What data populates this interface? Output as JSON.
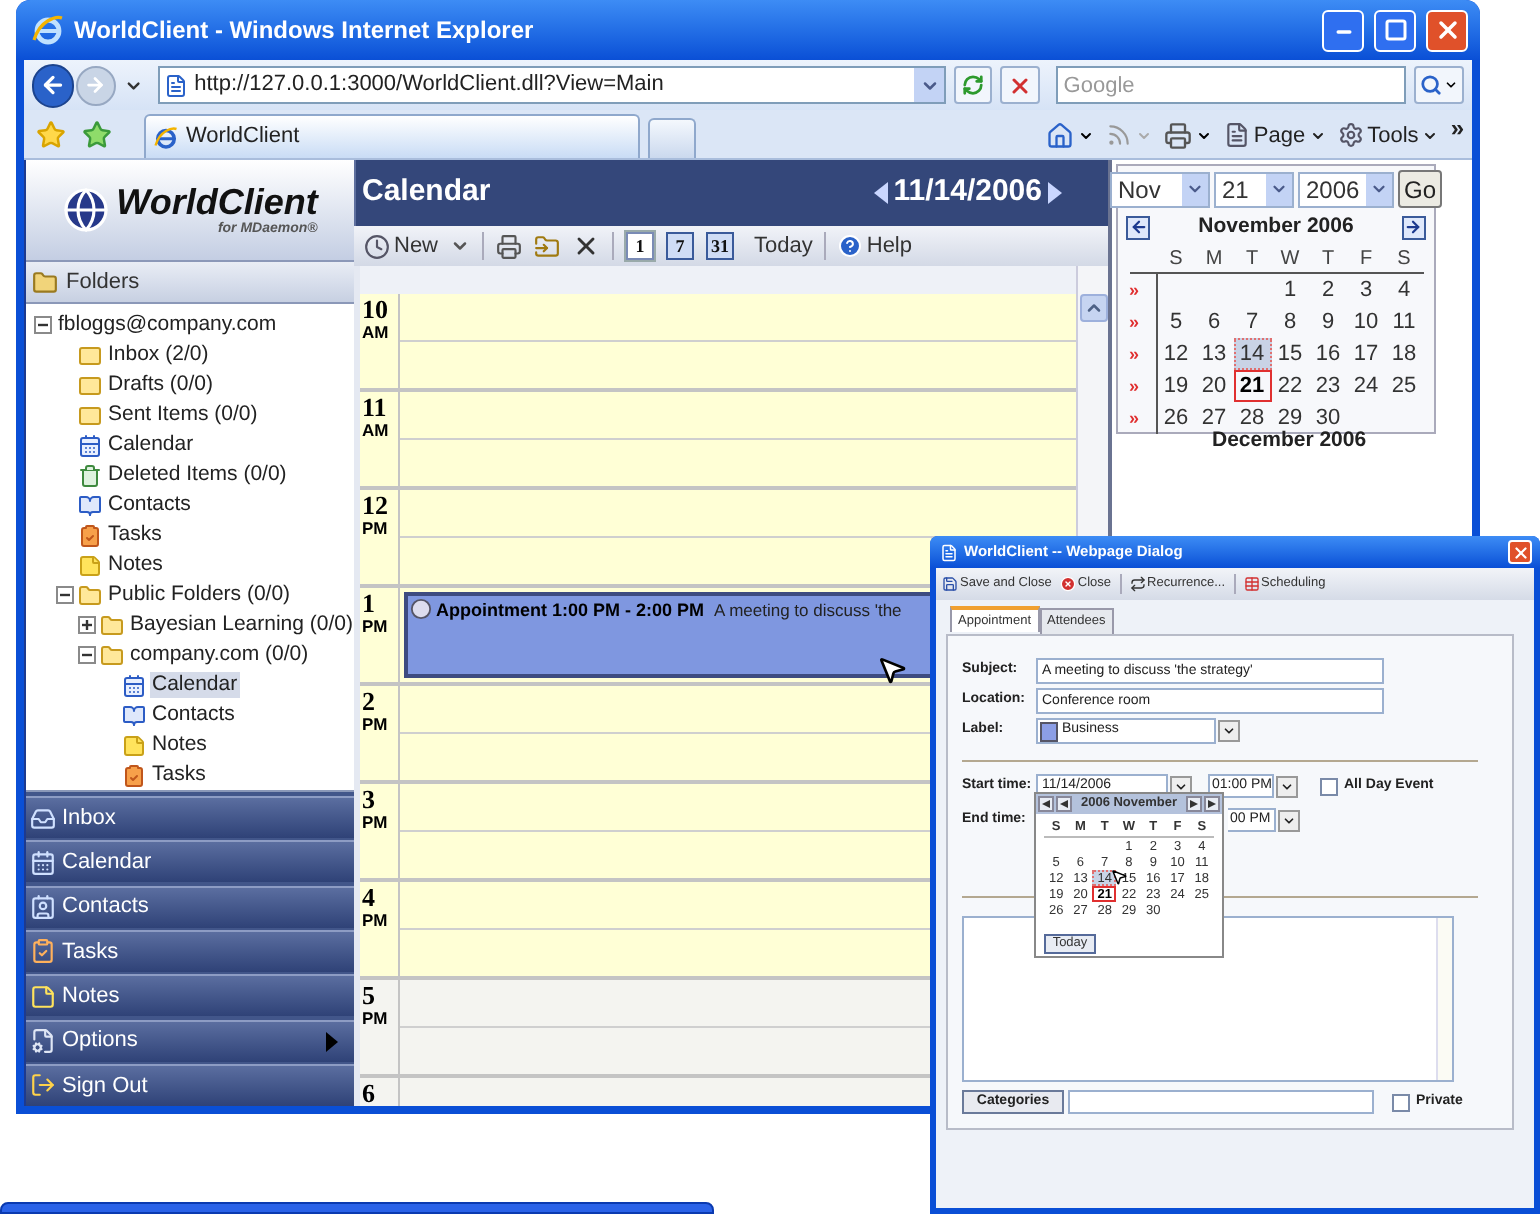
{
  "browser": {
    "title": "WorldClient - Windows Internet Explorer",
    "address": "http://127.0.0.1:3000/WorldClient.dll?View=Main",
    "search_placeholder": "Google",
    "tab": "WorldClient",
    "commands": [
      {
        "label": "Page",
        "kind": "page"
      },
      {
        "label": "Tools",
        "kind": "tools"
      }
    ],
    "more": "»"
  },
  "logo": {
    "title": "WorldClient",
    "subtitle": "for MDaemon®"
  },
  "folders": {
    "title": "Folders",
    "tree": [
      {
        "label": "fbloggs@company.com",
        "expanded": true,
        "selected": false,
        "children": [
          {
            "label": "Inbox (2/0)",
            "kind": "mail",
            "selected": false
          },
          {
            "label": "Drafts (0/0)",
            "kind": "mail",
            "selected": false
          },
          {
            "label": "Sent Items (0/0)",
            "kind": "mail",
            "selected": false
          },
          {
            "label": "Calendar",
            "kind": "calendar",
            "selected": false
          },
          {
            "label": "Deleted Items (0/0)",
            "kind": "trash",
            "selected": false
          },
          {
            "label": "Contacts",
            "kind": "contacts",
            "selected": false
          },
          {
            "label": "Tasks",
            "kind": "tasks",
            "selected": false
          },
          {
            "label": "Notes",
            "kind": "notes",
            "selected": false
          },
          {
            "label": "Public Folders (0/0)",
            "kind": "folder",
            "expanded": true,
            "selected": false,
            "children": [
              {
                "label": "Bayesian Learning (0/0)",
                "kind": "folder",
                "expanded": false,
                "selected": false
              },
              {
                "label": "company.com (0/0)",
                "kind": "folder",
                "expanded": true,
                "selected": false,
                "children": [
                  {
                    "label": "Calendar",
                    "kind": "calendar",
                    "selected": true
                  },
                  {
                    "label": "Contacts",
                    "kind": "contacts",
                    "selected": false
                  },
                  {
                    "label": "Notes",
                    "kind": "notes",
                    "selected": false
                  },
                  {
                    "label": "Tasks",
                    "kind": "tasks",
                    "selected": false
                  }
                ]
              }
            ]
          }
        ]
      }
    ]
  },
  "nav": [
    {
      "label": "Inbox",
      "kind": "inbox",
      "submenu": false
    },
    {
      "label": "Calendar",
      "kind": "calendar",
      "submenu": false
    },
    {
      "label": "Contacts",
      "kind": "contacts",
      "submenu": false
    },
    {
      "label": "Tasks",
      "kind": "tasks",
      "submenu": false
    },
    {
      "label": "Notes",
      "kind": "notes",
      "submenu": false
    },
    {
      "label": "Options",
      "kind": "options",
      "submenu": true
    },
    {
      "label": "Sign Out",
      "kind": "signout",
      "submenu": false
    }
  ],
  "calendar": {
    "title": "Calendar",
    "date": "11/14/2006",
    "toolbar": {
      "new": "New",
      "views": [
        {
          "label": "1",
          "selected": true
        },
        {
          "label": "7",
          "selected": false
        },
        {
          "label": "31",
          "selected": false
        }
      ],
      "today": "Today",
      "help": "Help"
    },
    "hours": [
      {
        "hour": "10",
        "period": "AM",
        "working": true
      },
      {
        "hour": "11",
        "period": "AM",
        "working": true
      },
      {
        "hour": "12",
        "period": "PM",
        "working": true
      },
      {
        "hour": "1",
        "period": "PM",
        "working": true,
        "appointments": [
          {
            "title": "Appointment 1:00 PM - 2:00 PM",
            "description": "A meeting to discuss 'the"
          }
        ]
      },
      {
        "hour": "2",
        "period": "PM",
        "working": true
      },
      {
        "hour": "3",
        "period": "PM",
        "working": true
      },
      {
        "hour": "4",
        "period": "PM",
        "working": true
      },
      {
        "hour": "5",
        "period": "PM",
        "working": false
      },
      {
        "hour": "6",
        "working": false
      }
    ]
  },
  "mini_calendar": {
    "month_select": "Nov",
    "day_select": "21",
    "year_select": "2006",
    "go": "Go",
    "month_title": "November 2006",
    "weekdays": [
      "S",
      "M",
      "T",
      "W",
      "T",
      "F",
      "S"
    ],
    "weeks": [
      {
        "marker": "»",
        "days": [
          {
            "kind": "blank"
          },
          {
            "kind": "blank"
          },
          {
            "kind": "blank"
          },
          {
            "kind": "day",
            "day": "1",
            "selected": false,
            "today": false
          },
          {
            "kind": "day",
            "day": "2",
            "selected": false,
            "today": false
          },
          {
            "kind": "day",
            "day": "3",
            "selected": false,
            "today": false
          },
          {
            "kind": "day",
            "day": "4",
            "selected": false,
            "today": false
          }
        ]
      },
      {
        "marker": "»",
        "days": [
          {
            "kind": "day",
            "day": "5",
            "selected": false,
            "today": false
          },
          {
            "kind": "day",
            "day": "6",
            "selected": false,
            "today": false
          },
          {
            "kind": "day",
            "day": "7",
            "selected": false,
            "today": false
          },
          {
            "kind": "day",
            "day": "8",
            "selected": false,
            "today": false
          },
          {
            "kind": "day",
            "day": "9",
            "selected": false,
            "today": false
          },
          {
            "kind": "day",
            "day": "10",
            "selected": false,
            "today": false
          },
          {
            "kind": "day",
            "day": "11",
            "selected": false,
            "today": false
          }
        ]
      },
      {
        "marker": "»",
        "days": [
          {
            "kind": "day",
            "day": "12",
            "selected": false,
            "today": false
          },
          {
            "kind": "day",
            "day": "13",
            "selected": false,
            "today": false
          },
          {
            "kind": "day",
            "day": "14",
            "selected": true,
            "today": false
          },
          {
            "kind": "day",
            "day": "15",
            "selected": false,
            "today": false
          },
          {
            "kind": "day",
            "day": "16",
            "selected": false,
            "today": false
          },
          {
            "kind": "day",
            "day": "17",
            "selected": false,
            "today": false
          },
          {
            "kind": "day",
            "day": "18",
            "selected": false,
            "today": false
          }
        ]
      },
      {
        "marker": "»",
        "days": [
          {
            "kind": "day",
            "day": "19",
            "selected": false,
            "today": false
          },
          {
            "kind": "day",
            "day": "20",
            "selected": false,
            "today": false
          },
          {
            "kind": "day",
            "day": "21",
            "selected": false,
            "today": true
          },
          {
            "kind": "day",
            "day": "22",
            "selected": false,
            "today": false
          },
          {
            "kind": "day",
            "day": "23",
            "selected": false,
            "today": false
          },
          {
            "kind": "day",
            "day": "24",
            "selected": false,
            "today": false
          },
          {
            "kind": "day",
            "day": "25",
            "selected": false,
            "today": false
          }
        ]
      },
      {
        "marker": "»",
        "days": [
          {
            "kind": "day",
            "day": "26",
            "selected": false,
            "today": false
          },
          {
            "kind": "day",
            "day": "27",
            "selected": false,
            "today": false
          },
          {
            "kind": "day",
            "day": "28",
            "selected": false,
            "today": false
          },
          {
            "kind": "day",
            "day": "29",
            "selected": false,
            "today": false
          },
          {
            "kind": "day",
            "day": "30",
            "selected": false,
            "today": false
          },
          {
            "kind": "blank"
          },
          {
            "kind": "blank"
          }
        ]
      }
    ],
    "next_month_title": "December 2006"
  },
  "dialog": {
    "title": "WorldClient -- Webpage Dialog",
    "toolbar": [
      {
        "label": "Save and Close",
        "kind": "save"
      },
      {
        "label": "Close",
        "kind": "close"
      },
      {
        "label": "Recurrence...",
        "kind": "recurrence"
      },
      {
        "label": "Scheduling",
        "kind": "scheduling"
      }
    ],
    "tabs": [
      {
        "label": "Appointment",
        "selected": true
      },
      {
        "label": "Attendees",
        "selected": false
      }
    ],
    "subject": {
      "label": "Subject:",
      "value": "A meeting to discuss 'the strategy'"
    },
    "location": {
      "label": "Location:",
      "value": "Conference room"
    },
    "event_label": {
      "label": "Label:",
      "value": "Business"
    },
    "start": {
      "label": "Start time:",
      "date": "11/14/2006",
      "time": "01:00 PM"
    },
    "all_day": {
      "label": "All Day Event",
      "checked": false
    },
    "end": {
      "label": "End time:",
      "time": "00 PM"
    },
    "date_picker": {
      "title": "2006 November",
      "weekdays": [
        "S",
        "M",
        "T",
        "W",
        "T",
        "F",
        "S"
      ],
      "weeks": [
        {
          "days": [
            {
              "kind": "blank"
            },
            {
              "kind": "blank"
            },
            {
              "kind": "blank"
            },
            {
              "kind": "day",
              "day": "1",
              "selected": false,
              "today": false
            },
            {
              "kind": "day",
              "day": "2",
              "selected": false,
              "today": false
            },
            {
              "kind": "day",
              "day": "3",
              "selected": false,
              "today": false
            },
            {
              "kind": "day",
              "day": "4",
              "selected": false,
              "today": false
            }
          ]
        },
        {
          "days": [
            {
              "kind": "day",
              "day": "5",
              "selected": false,
              "today": false
            },
            {
              "kind": "day",
              "day": "6",
              "selected": false,
              "today": false
            },
            {
              "kind": "day",
              "day": "7",
              "selected": false,
              "today": false
            },
            {
              "kind": "day",
              "day": "8",
              "selected": false,
              "today": false
            },
            {
              "kind": "day",
              "day": "9",
              "selected": false,
              "today": false
            },
            {
              "kind": "day",
              "day": "10",
              "selected": false,
              "today": false
            },
            {
              "kind": "day",
              "day": "11",
              "selected": false,
              "today": false
            }
          ]
        },
        {
          "days": [
            {
              "kind": "day",
              "day": "12",
              "selected": false,
              "today": false
            },
            {
              "kind": "day",
              "day": "13",
              "selected": false,
              "today": false
            },
            {
              "kind": "day",
              "day": "14",
              "selected": true,
              "today": false
            },
            {
              "kind": "day",
              "day": "15",
              "selected": false,
              "today": false
            },
            {
              "kind": "day",
              "day": "16",
              "selected": false,
              "today": false
            },
            {
              "kind": "day",
              "day": "17",
              "selected": false,
              "today": false
            },
            {
              "kind": "day",
              "day": "18",
              "selected": false,
              "today": false
            }
          ]
        },
        {
          "days": [
            {
              "kind": "day",
              "day": "19",
              "selected": false,
              "today": false
            },
            {
              "kind": "day",
              "day": "20",
              "selected": false,
              "today": false
            },
            {
              "kind": "day",
              "day": "21",
              "selected": false,
              "today": true
            },
            {
              "kind": "day",
              "day": "22",
              "selected": false,
              "today": false
            },
            {
              "kind": "day",
              "day": "23",
              "selected": false,
              "today": false
            },
            {
              "kind": "day",
              "day": "24",
              "selected": false,
              "today": false
            },
            {
              "kind": "day",
              "day": "25",
              "selected": false,
              "today": false
            }
          ]
        },
        {
          "days": [
            {
              "kind": "day",
              "day": "26",
              "selected": false,
              "today": false
            },
            {
              "kind": "day",
              "day": "27",
              "selected": false,
              "today": false
            },
            {
              "kind": "day",
              "day": "28",
              "selected": false,
              "today": false
            },
            {
              "kind": "day",
              "day": "29",
              "selected": false,
              "today": false
            },
            {
              "kind": "day",
              "day": "30",
              "selected": false,
              "today": false
            },
            {
              "kind": "blank"
            },
            {
              "kind": "blank"
            }
          ]
        }
      ],
      "today": "Today"
    },
    "categories": "Categories",
    "private": {
      "label": "Private",
      "checked": false
    }
  }
}
